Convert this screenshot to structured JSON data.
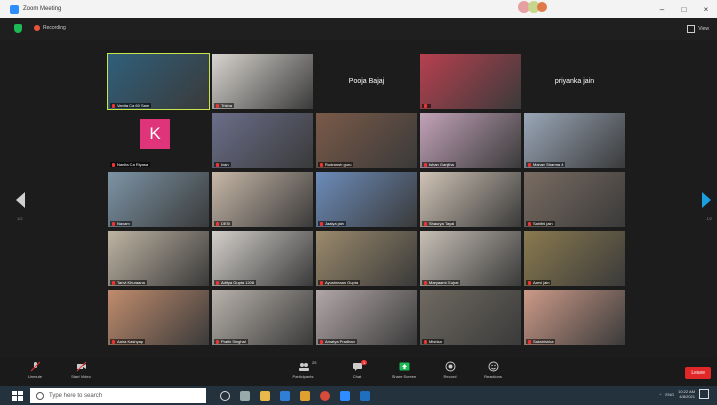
{
  "window": {
    "title": "Zoom Meeting"
  },
  "meeting": {
    "recording_label": "Recording",
    "view_label": "View"
  },
  "nav": {
    "page_left": "1/2",
    "page_right": "1/2"
  },
  "tiles": [
    {
      "name": "Vanita Ca 60 Sam",
      "scene": "#2f5f7a"
    },
    {
      "name": "Trisha",
      "scene": "#d8d4cf"
    },
    {
      "name": "Pooja Bajaj",
      "scene": "#1c1c1c",
      "center": true
    },
    {
      "name": "",
      "scene": "#b7404f"
    },
    {
      "name": "priyanka jain",
      "scene": "#1c1c1c",
      "center": true
    },
    {
      "name": "Nanita Ca Riyasa",
      "scene": "#1c1c1c",
      "avatar": "K"
    },
    {
      "name": "Ivan",
      "scene": "#6b6e8a"
    },
    {
      "name": "Rudransh guru",
      "scene": "#7a5a48"
    },
    {
      "name": "Ishan Ganjtha",
      "scene": "#c2a2b8"
    },
    {
      "name": "Manav Sharma 4",
      "scene": "#9aa7b8"
    },
    {
      "name": "Navam",
      "scene": "#7c94a6"
    },
    {
      "name": "DESI",
      "scene": "#c8b8a8"
    },
    {
      "name": "Jaaiya jain",
      "scene": "#6c8cba"
    },
    {
      "name": "Shaurya Tayal",
      "scene": "#cfc3b5"
    },
    {
      "name": "Sahithi jain",
      "scene": "#7a6c62"
    },
    {
      "name": "Tanvi Khuraana",
      "scene": "#bfb4a3"
    },
    {
      "name": "Aditya Gupta 1208",
      "scene": "#d3cfcb"
    },
    {
      "name": "Ayushmaan Gupta",
      "scene": "#9b8a6c"
    },
    {
      "name": "Maryaami Gujral",
      "scene": "#c6bfb5"
    },
    {
      "name": "Aarvi jain",
      "scene": "#8a7a4f"
    },
    {
      "name": "Aaira Kashyap",
      "scene": "#c08c6d"
    },
    {
      "name": "Pratik Singhal",
      "scene": "#b8b2ab"
    },
    {
      "name": "Amatya Pradhan",
      "scene": "#b2a7a8"
    },
    {
      "name": "Mishka",
      "scene": "#6f6a61"
    },
    {
      "name": "Sakshishka",
      "scene": "#cc9a88"
    }
  ],
  "toolbar": {
    "mute": "Unmute",
    "video": "Start Video",
    "participants": "Participants",
    "participants_count": "25",
    "chat": "Chat",
    "chat_badge": "1",
    "share": "Share Screen",
    "record": "Record",
    "reactions": "Reactions",
    "end": "Leave"
  },
  "taskbar": {
    "search_placeholder": "Type here to search",
    "time": "10:22 AM",
    "date": "4/8/2021",
    "lang": "ENG"
  },
  "colors": {
    "share_green": "#1db954",
    "end_red": "#e02828",
    "active_border": "#c8e64a"
  }
}
